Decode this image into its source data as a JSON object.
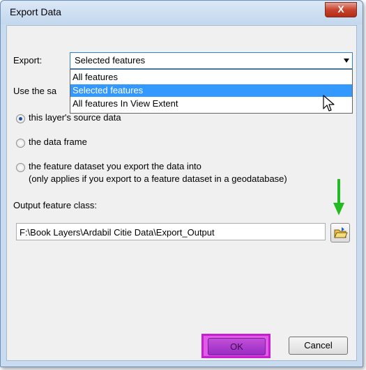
{
  "window": {
    "title": "Export Data",
    "close_label": "X"
  },
  "export": {
    "label": "Export:",
    "selected": "Selected features",
    "options": [
      "All features",
      "Selected features",
      "All features In View Extent"
    ]
  },
  "coord_section": {
    "label_partial": "Use the sa",
    "options": [
      {
        "label": "this layer's source data",
        "checked": true
      },
      {
        "label": "the data frame",
        "checked": false
      },
      {
        "label": "the feature dataset you export the data into",
        "checked": false
      }
    ],
    "note": "(only applies if you export to a feature dataset in a geodatabase)"
  },
  "output": {
    "label": "Output feature class:",
    "path": "F:\\Book Layers\\Ardabil Citie Data\\Export_Output"
  },
  "buttons": {
    "ok": "OK",
    "cancel": "Cancel"
  },
  "colors": {
    "highlight": "#3399ff",
    "annotation_arrow": "#22bb22",
    "ok_highlight": "#c81ed2"
  }
}
